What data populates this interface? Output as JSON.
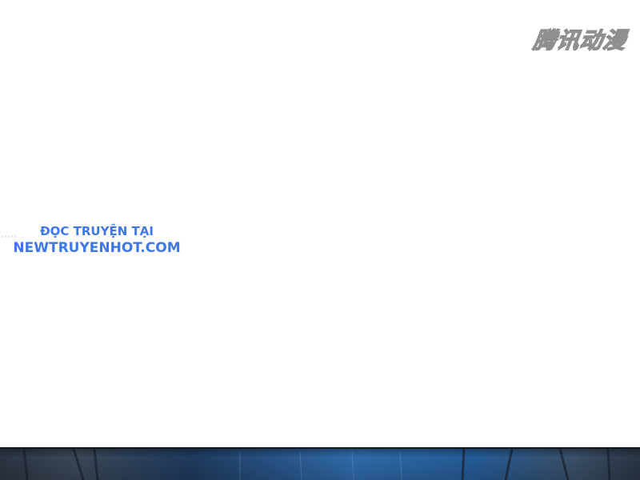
{
  "publisher": {
    "logo_text": "腾讯动漫",
    "logo_icon": "tencent-comic-logo"
  },
  "watermark": {
    "line1": "ĐỌC TRUYỆN TẠI",
    "line2": "NEWTRUYENHOT.COM",
    "color": "#3f77e8"
  },
  "colors": {
    "background": "#ffffff",
    "panel_dark": "#1c2a3c",
    "panel_blue": "#2c5f9e"
  }
}
